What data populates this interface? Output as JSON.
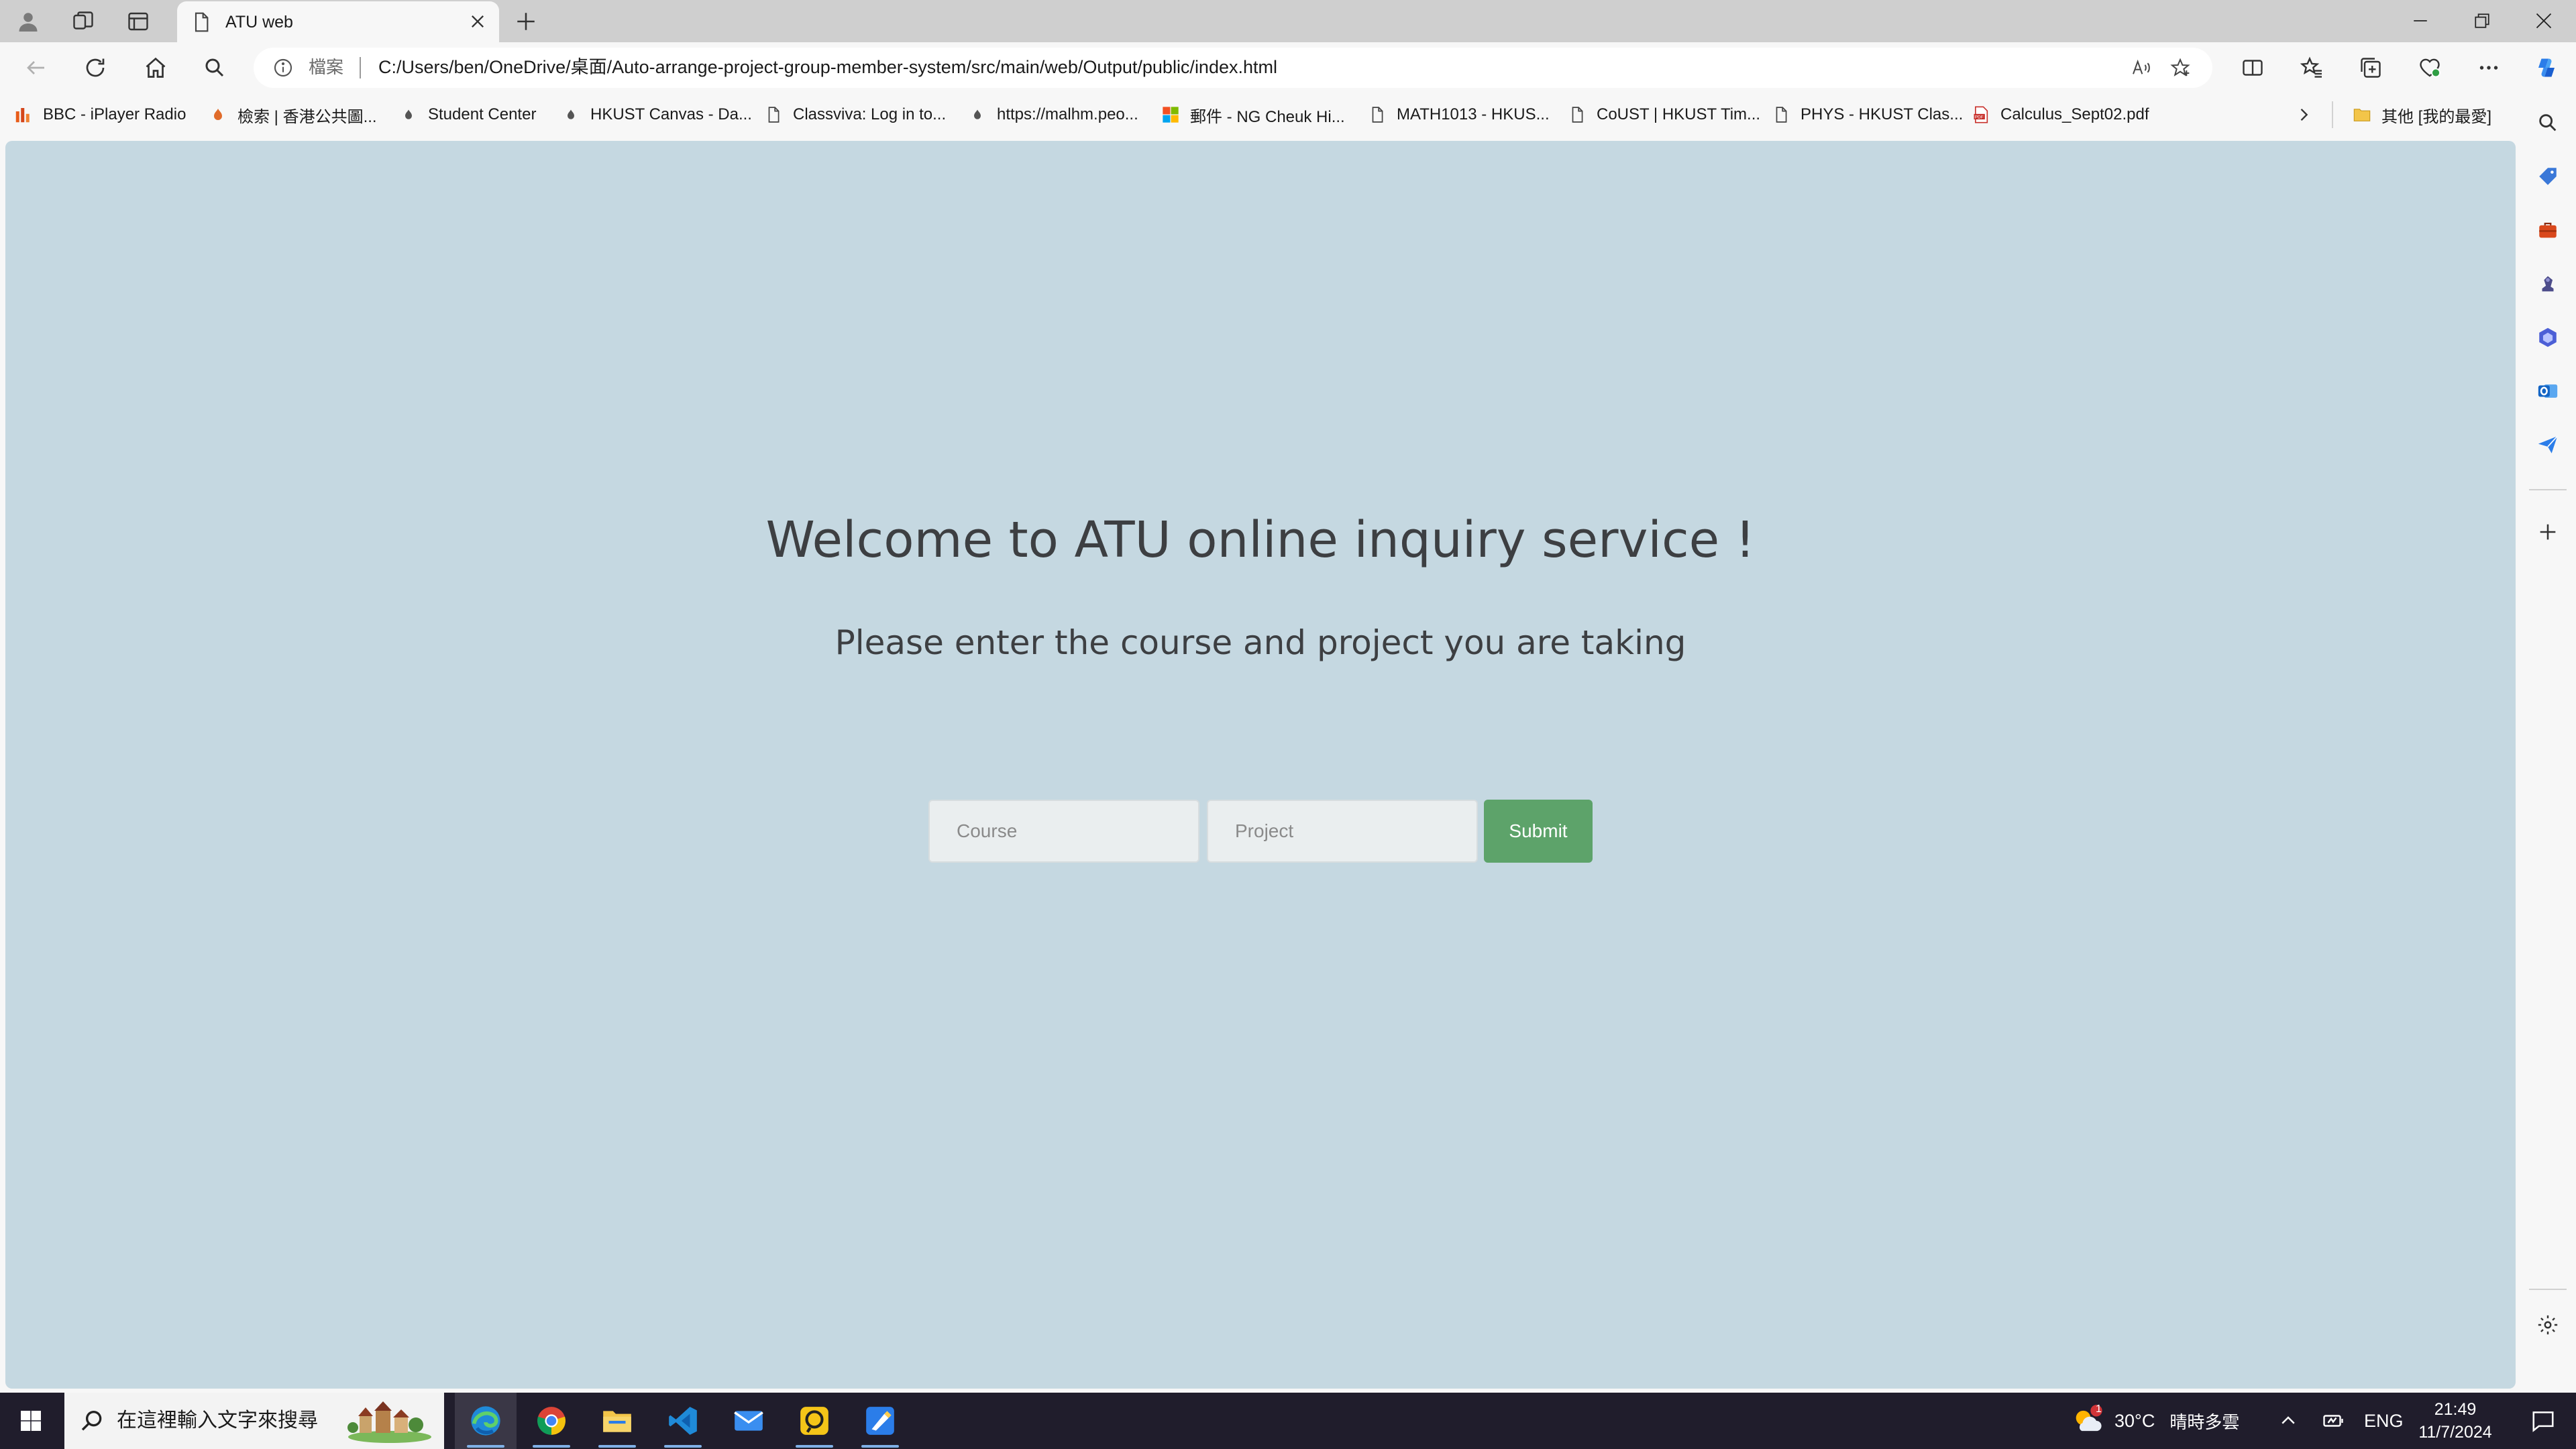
{
  "browser": {
    "tab_title": "ATU web",
    "address_label": "檔案",
    "url": "C:/Users/ben/OneDrive/桌面/Auto-arrange-project-group-member-system/src/main/web/Output/public/index.html"
  },
  "favorites": [
    {
      "label": "BBC - iPlayer Radio",
      "icon": "bbc-icon"
    },
    {
      "label": "檢索 | 香港公共圖...",
      "icon": "library-icon"
    },
    {
      "label": "Student Center",
      "icon": "site-icon"
    },
    {
      "label": "HKUST Canvas - Da...",
      "icon": "site-icon"
    },
    {
      "label": "Classviva: Log in to...",
      "icon": "page-icon"
    },
    {
      "label": "https://malhm.peo...",
      "icon": "site-icon"
    },
    {
      "label": "郵件 - NG Cheuk Hi...",
      "icon": "microsoft-icon"
    },
    {
      "label": "MATH1013 - HKUS...",
      "icon": "page-icon"
    },
    {
      "label": "CoUST | HKUST Tim...",
      "icon": "page-icon"
    },
    {
      "label": "PHYS - HKUST Clas...",
      "icon": "page-icon"
    },
    {
      "label": "Calculus_Sept02.pdf",
      "icon": "pdf-icon"
    }
  ],
  "other_favorites": "其他 [我的最愛]",
  "page": {
    "heading": "Welcome to ATU online inquiry service !",
    "subheading": "Please enter the course and project you are taking",
    "course_placeholder": "Course",
    "project_placeholder": "Project",
    "submit_label": "Submit"
  },
  "taskbar": {
    "search_placeholder": "在這裡輸入文字來搜尋",
    "weather_temp": "30°C",
    "weather_text": "晴時多雲",
    "weather_badge": "1",
    "language": "ENG",
    "time": "21:49",
    "date": "11/7/2024"
  },
  "colors": {
    "page_background": "#c5d8e1",
    "submit_button": "#5da36a",
    "heading_text": "#3d3f42",
    "taskbar": "#201d2c"
  }
}
